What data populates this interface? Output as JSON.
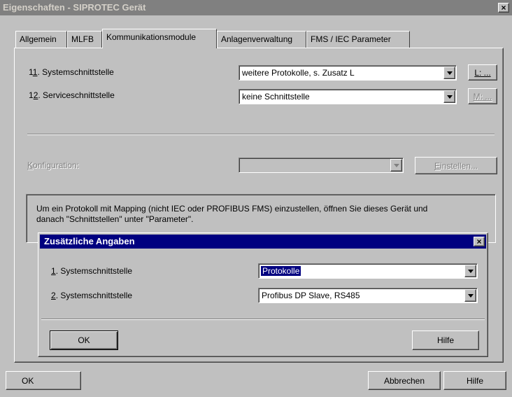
{
  "window": {
    "title": "Eigenschaften - SIPROTEC Gerät",
    "close_glyph": "×"
  },
  "tabs": [
    {
      "label": "Allgemein"
    },
    {
      "label": "MLFB"
    },
    {
      "label": "Kommunikationsmodule"
    },
    {
      "label": "Anlagenverwaltung"
    },
    {
      "label": "FMS / IEC Parameter"
    }
  ],
  "rows": [
    {
      "label_pre": "1",
      "label_ul": "1",
      "label_post": ". Systemschnittstelle",
      "value": "weitere Protokolle, s. Zusatz L",
      "button": "L: ..."
    },
    {
      "label_pre": "1",
      "label_ul": "2",
      "label_post": ". Serviceschnittstelle",
      "value": "keine Schnittstelle",
      "button": "M: ..."
    }
  ],
  "konfiguration": {
    "label_ul": "K",
    "label_rest": "onfiguration:",
    "value": "",
    "button_ul": "E",
    "button_rest": "instellen..."
  },
  "info_text_1": "Um ein Protokoll mit Mapping (nicht IEC oder PROFIBUS FMS) einzustellen, öffnen Sie dieses Gerät und",
  "info_text_2": "danach \"Schnittstellen\" unter \"Parameter\".",
  "dialog": {
    "title": "Zusätzliche Angaben",
    "close_glyph": "×",
    "rows": [
      {
        "num": "1",
        "label": ".  Systemschnittstelle",
        "value": "Protokolle"
      },
      {
        "num": "2",
        "label": ".  Systemschnittstelle",
        "value": "Profibus DP Slave, RS485"
      }
    ],
    "ok": "OK",
    "help": "Hilfe"
  },
  "footer": {
    "ok": "OK",
    "cancel": "Abbrechen",
    "help": "Hilfe"
  }
}
